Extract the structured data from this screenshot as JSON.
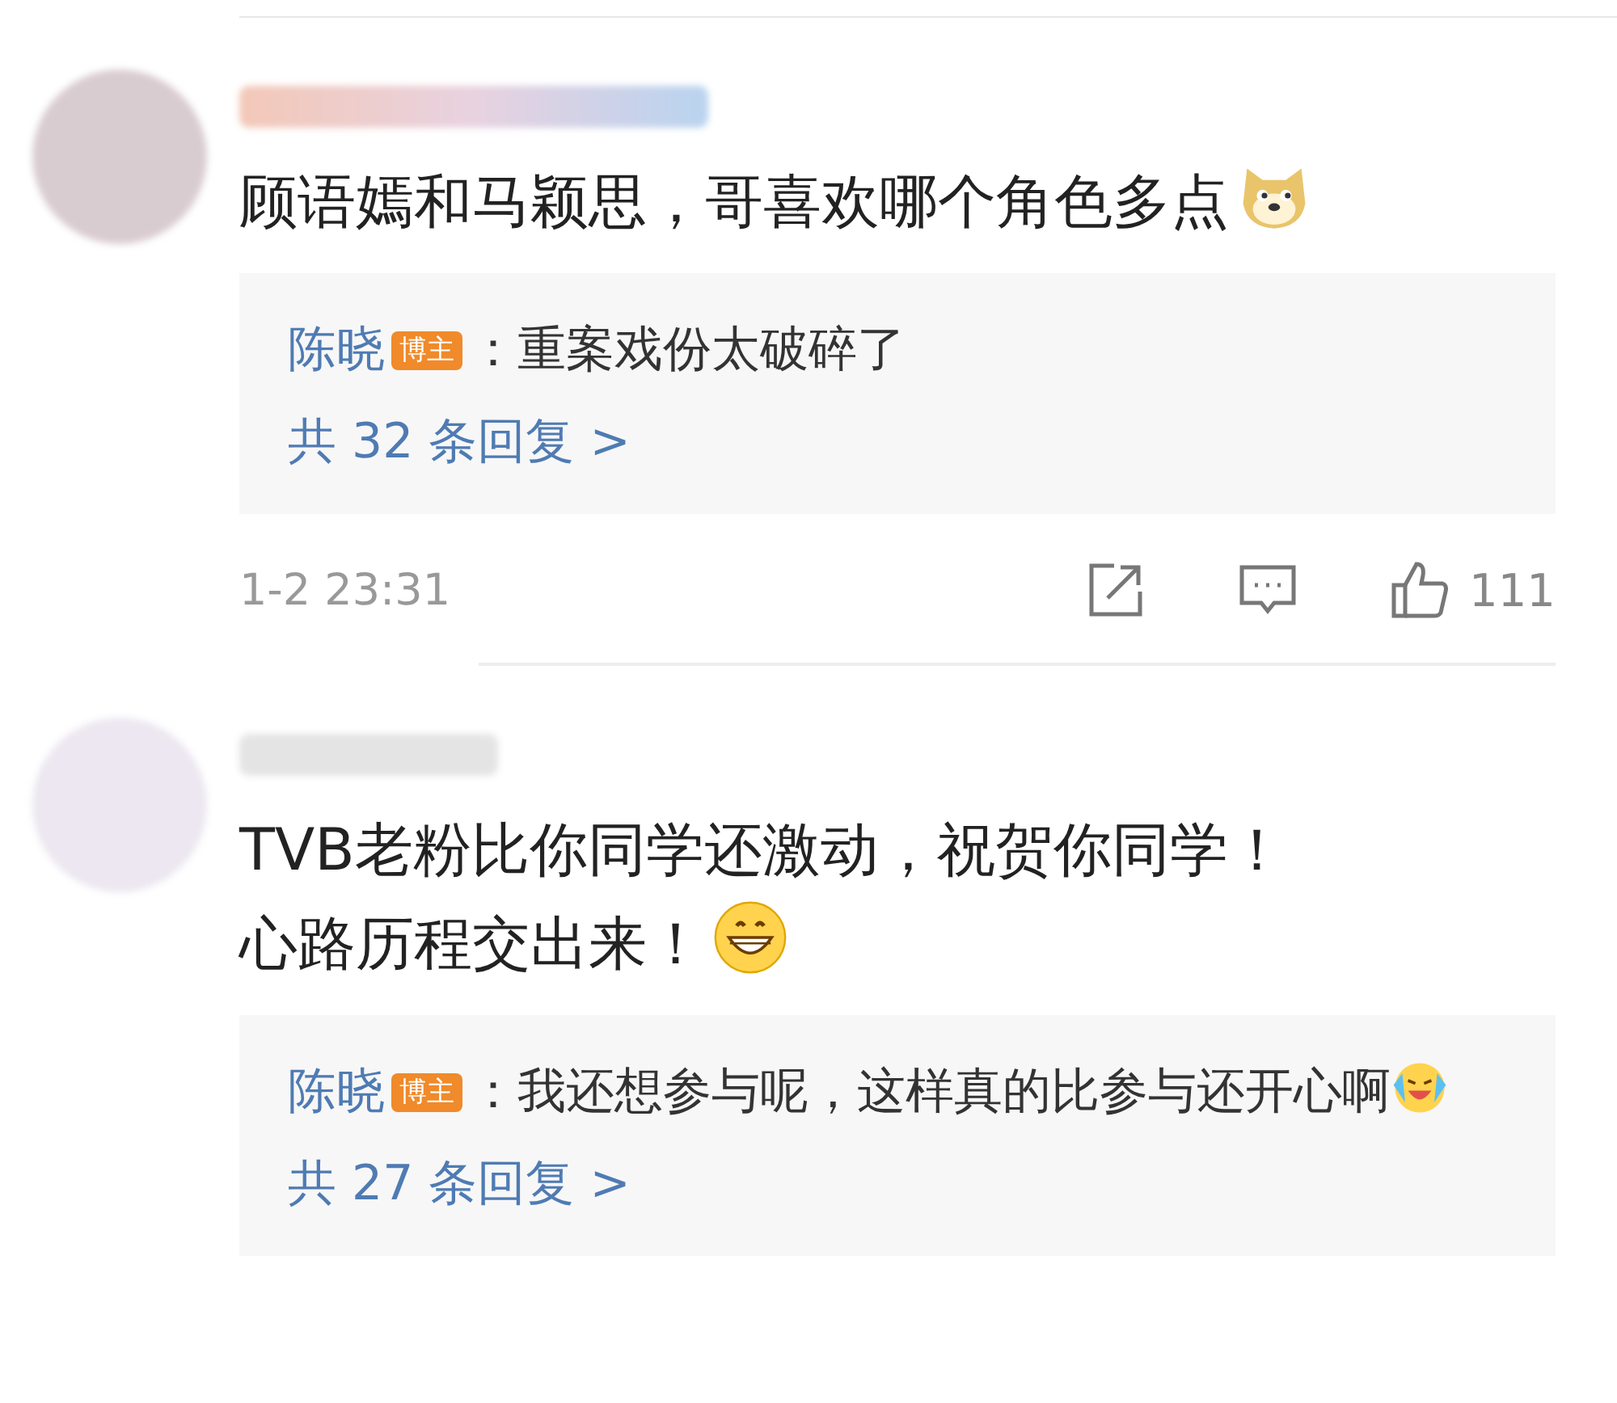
{
  "comments": [
    {
      "lines": [
        "顾语嫣和马颖思，哥喜欢哪个角色多点"
      ],
      "emoji": {
        "kind": "doge"
      },
      "reply": {
        "author": "陈晓",
        "badge": "博主",
        "text": "：重案戏份太破碎了",
        "more": "共 32 条回复 >"
      },
      "footer": {
        "time": "1-2 23:31",
        "likes": "111"
      }
    },
    {
      "lines": [
        "TVB老粉比你同学还激动，祝贺你同学！",
        "心路历程交出来！"
      ],
      "emoji": {
        "kind": "grin"
      },
      "reply": {
        "author": "陈晓",
        "badge": "博主",
        "text": "：我还想参与呢，这样真的比参与还开心啊",
        "emoji": {
          "kind": "laugh-cry"
        },
        "more": "共 27 条回复 >"
      }
    }
  ]
}
